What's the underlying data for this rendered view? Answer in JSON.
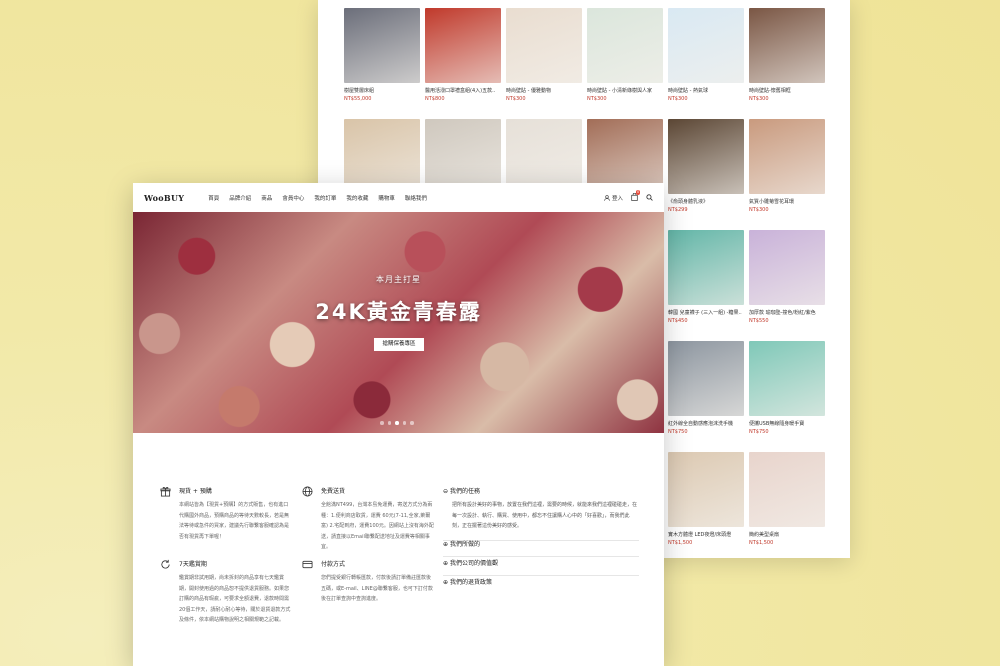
{
  "back_products": [
    {
      "name": "樹屋雙層床組",
      "price": "NT$55,000",
      "color": "#6b6e7a"
    },
    {
      "name": "醫用活潑口罩禮盒組(4入)五款..",
      "price": "NT$800",
      "color": "#c0392b"
    },
    {
      "name": "時尚壁貼 - 優雅動物",
      "price": "NT$300",
      "color": "#e9ddd0"
    },
    {
      "name": "時尚壁貼 - 小清新綠樹與人家",
      "price": "NT$300",
      "color": "#dbe6dc"
    },
    {
      "name": "時尚壁貼 - 熱氣球",
      "price": "NT$300",
      "color": "#d9e9f3"
    },
    {
      "name": "時尚壁貼-懷舊相框",
      "price": "NT$300",
      "color": "#7a5644"
    },
    {
      "name": "",
      "price": "",
      "color": "#d9c4a8"
    },
    {
      "name": "",
      "price": "",
      "color": "#cfc8be"
    },
    {
      "name": "",
      "price": "",
      "color": "#e6e0d8"
    },
    {
      "name": "",
      "price": "",
      "color": "#a26d57"
    },
    {
      "name": "《俞頭身體乳液》",
      "price": "NT$299",
      "color": "#5b4634"
    },
    {
      "name": "氣質小雛菊雪花耳環",
      "price": "NT$300",
      "color": "#c99a7e"
    },
    {
      "name": "韓國 兒童襪子 (三入一組) -糖果..",
      "price": "NT$450",
      "color": "#63b6a8"
    },
    {
      "name": "加厚款 瑜珈墊-撞色/粉紅/紫色",
      "price": "NT$550",
      "color": "#c9b2d9"
    },
    {
      "name": "紅外線全自動感應泡沫洗手機",
      "price": "NT$750",
      "color": "#8d96a0"
    },
    {
      "name": "便攜USB無線隨身暖手寶",
      "price": "NT$750",
      "color": "#7fc8b8"
    },
    {
      "name": "實木方體燈 LED夜燈/床頭燈",
      "price": "NT$1,500",
      "color": "#dcc9b2"
    },
    {
      "name": "簡約美型桌扇",
      "price": "NT$1,500",
      "color": "#e8d4cc"
    }
  ],
  "nav": {
    "logo": "WooBUY",
    "menu": [
      "首頁",
      "品牌介紹",
      "商品",
      "會員中心",
      "我的訂單",
      "我的收藏",
      "購物車",
      "聯絡我們"
    ],
    "login": "登入",
    "cart_count": "0"
  },
  "hero": {
    "subtitle": "本月主打星",
    "title": "24K黃金青春露",
    "button": "搶購保養專區"
  },
  "features": [
    {
      "title": "現貨 + 預購",
      "icon": "gift-icon",
      "text": "本網站皆為【現貨+預購】的方式販售，也有進口代購國外商品，預購商品的等待天數較長，若是無法等待或急件的買家，建議先行聯繫客服確認為是否有現貨再下單喔！"
    },
    {
      "title": "免費送貨",
      "icon": "globe-icon",
      "text": "全館滿NT499，台灣本島免運費，寄送方式分為兩種：1.便利商店取貨，運費 60元(7-11,全家,萊爾富) 2.宅配到府，運費100元。因網站上沒有海外配送，請直接以Email聯繫配送地址及運費等相關事宜。"
    },
    {
      "title": "7天鑑賞期",
      "icon": "refresh-icon",
      "text": "鑑賞期非試用期，尚未拆封的商品享有七天鑑賞期，開封使用過的商品恕不提供退貨服務。如果您訂購的商品有瑕疵，可要求全額退費，退款時間需20個工作天，請耐心耐心等待，關於退貨退款方式及條件，依本網站購物說明之相關規範之記載。"
    },
    {
      "title": "付款方式",
      "icon": "card-icon",
      "text": "您們提受銀行轉帳匯款，付款後請訂單備註匯款後五碼，或E-mail、LINE@聯繫客服，也可下訂付款後在訂單查詢中查詢進度。"
    }
  ],
  "accordion": [
    {
      "title": "我們的任務",
      "text": "把所有設計美好的事物，放置在我們這裡，需要的時候，就能來我們這裡碰碰走，在每一次設計、執行、購買、使用中，都忘不住讓購人心中的「好喜歡」，而我們此刻，正在擺著這份美好的感受。"
    },
    {
      "title": "我們所做的",
      "text": ""
    },
    {
      "title": "我們公司的價值觀",
      "text": ""
    },
    {
      "title": "我們的退貨政策",
      "text": ""
    }
  ]
}
